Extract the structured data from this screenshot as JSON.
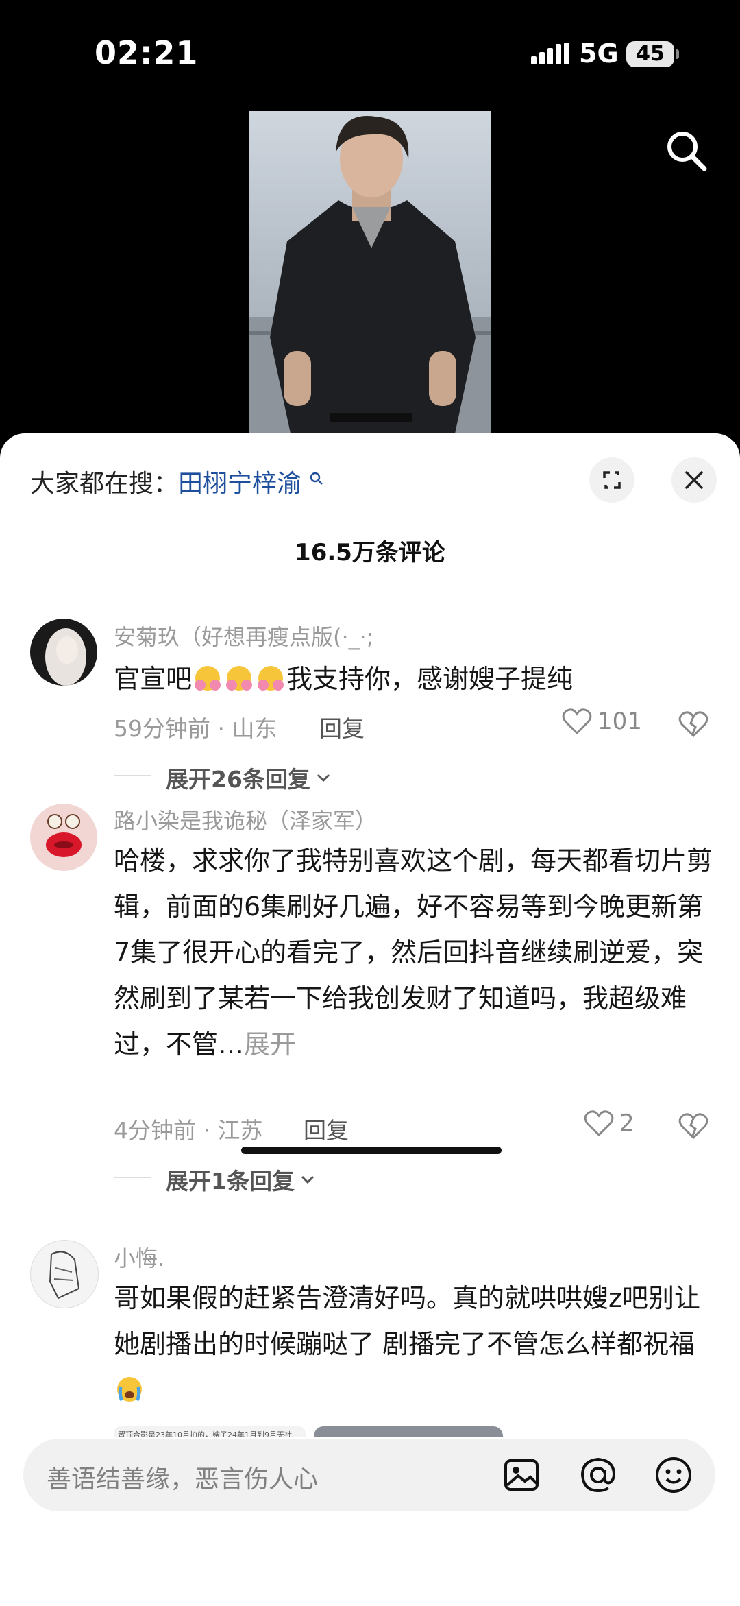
{
  "status": {
    "time": "02:21",
    "network": "5G",
    "battery": "45"
  },
  "search_bar": {
    "prefix": "大家都在搜：",
    "keyword": "田栩宁梓渝"
  },
  "comments_header": {
    "count": "16.5万条评论"
  },
  "comments": [
    {
      "user": "安菊玖（好想再瘦点版(·_·;",
      "text_a": "官宣吧",
      "text_b": "我支持你，感谢嫂子提纯",
      "meta": "59分钟前 · 山东",
      "reply": "回复",
      "likes": "101",
      "expand": "展开26条回复"
    },
    {
      "user": "路小染是我诡秘（泽家军）",
      "text": "哈楼，求求你了我特别喜欢这个剧，每天都看切片剪辑，前面的6集刷好几遍，好不容易等到今晚更新第7集了很开心的看完了，然后回抖音继续刷逆爱，突然刷到了某若一下给我创发财了知道吗，我超级难过，不管…",
      "more": "展开",
      "meta": "4分钟前 · 江苏",
      "reply": "回复",
      "likes": "2",
      "expand": "展开1条回复"
    },
    {
      "user": "小悔.",
      "text": "哥如果假的赶紧告澄清好吗。真的就哄哄嫂z吧别让她剧播出的时候蹦哒了 剧播完了不管怎么样都祝福"
    }
  ],
  "image_preview": {
    "caption": "置顶合影是23年10月拍的，嫂子24年1月到9月无社"
  },
  "input": {
    "placeholder": "善语结善缘，恶言伤人心"
  },
  "icons": [
    "search-icon",
    "expand-icon",
    "close-icon",
    "heart-icon",
    "broken-heart-icon",
    "chevron-down-icon",
    "image-icon",
    "at-icon",
    "emoji-icon"
  ]
}
